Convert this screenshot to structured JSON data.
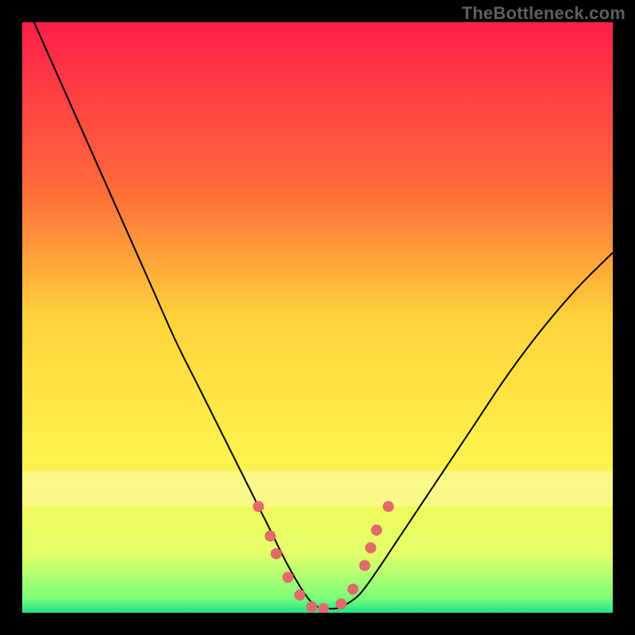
{
  "watermark": "TheBottleneck.com",
  "chart_data": {
    "type": "line",
    "title": "",
    "xlabel": "",
    "ylabel": "",
    "xlim": [
      0,
      100
    ],
    "ylim": [
      0,
      100
    ],
    "background_gradient_stops": [
      {
        "pos": 0.0,
        "color": "#ff1f4a"
      },
      {
        "pos": 0.28,
        "color": "#ff6a3a"
      },
      {
        "pos": 0.5,
        "color": "#ffd23a"
      },
      {
        "pos": 0.72,
        "color": "#fff04a"
      },
      {
        "pos": 0.9,
        "color": "#e4ff6a"
      },
      {
        "pos": 0.975,
        "color": "#7bff7a"
      },
      {
        "pos": 1.0,
        "color": "#20e28a"
      }
    ],
    "highlight_band": {
      "y0": 76,
      "y1": 82,
      "color": "#fffcb0",
      "opacity": 0.55
    },
    "series": [
      {
        "name": "bottleneck-curve",
        "type": "line",
        "color": "#000000",
        "width": 2,
        "x": [
          2,
          6,
          10,
          14,
          18,
          22,
          26,
          30,
          34,
          38,
          42,
          45,
          48,
          50,
          52,
          54,
          57,
          60,
          64,
          70,
          76,
          82,
          88,
          94,
          100
        ],
        "y": [
          100,
          91,
          82,
          73,
          64,
          55,
          46,
          38,
          30,
          22,
          14,
          8,
          3,
          1,
          0.7,
          1,
          3,
          7,
          13,
          22,
          31,
          40,
          48,
          55,
          61
        ]
      },
      {
        "name": "curve-markers",
        "type": "scatter",
        "color": "#e26a6a",
        "radius": 7,
        "x": [
          40,
          42,
          43,
          45,
          47,
          49,
          51,
          54,
          56,
          58,
          59,
          60,
          62
        ],
        "y": [
          18,
          13,
          10,
          6,
          3,
          1,
          0.7,
          1.5,
          4,
          8,
          11,
          14,
          18
        ]
      }
    ]
  }
}
